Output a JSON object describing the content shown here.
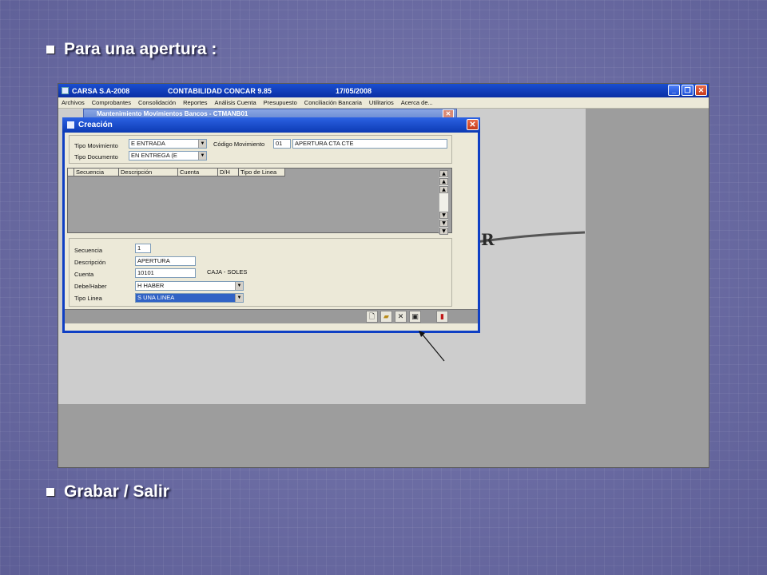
{
  "slide": {
    "bullet1": "Para una apertura :",
    "bullet2": "Grabar / Salir"
  },
  "app": {
    "title_company": "CARSA S.A-2008",
    "title_product": "CONTABILIDAD CONCAR 9.85",
    "title_date": "17/05/2008",
    "menu": [
      "Archivos",
      "Comprobantes",
      "Consolidación",
      "Reportes",
      "Análisis Cuenta",
      "Presupuesto",
      "Conciliación Bancaria",
      "Utilitarios",
      "Acerca de..."
    ],
    "child_title": "Mantenimiento Movimientos Bancos - CTMANB01",
    "logo_fragment": "R"
  },
  "dialog": {
    "title": "Creación",
    "tipo_movimiento_label": "Tipo Movimiento",
    "tipo_movimiento_value": "E   ENTRADA",
    "codigo_movimiento_label": "Código Movimiento",
    "codigo_movimiento_value": "01",
    "codigo_desc_value": "APERTURA CTA CTE",
    "tipo_documento_label": "Tipo Documento",
    "tipo_documento_value": "EN    ENTREGA (E",
    "grid_columns": [
      "",
      "Secuencia",
      "Descripción",
      "Cuenta",
      "D/H",
      "Tipo de Linea"
    ],
    "secuencia_label": "Secuencia",
    "secuencia_value": "1",
    "descripcion_label": "Descripción",
    "descripcion_value": "APERTURA",
    "cuenta_label": "Cuenta",
    "cuenta_value": "10101",
    "cuenta_desc": "CAJA - SOLES",
    "debe_haber_label": "Debe/Haber",
    "debe_haber_value": "H        HABER",
    "tipo_linea_label": "Tipo Linea",
    "tipo_linea_value": "S        UNA LINEA"
  },
  "icons": [
    "new-icon",
    "open-icon",
    "delete-icon",
    "save-icon",
    "exit-icon"
  ]
}
